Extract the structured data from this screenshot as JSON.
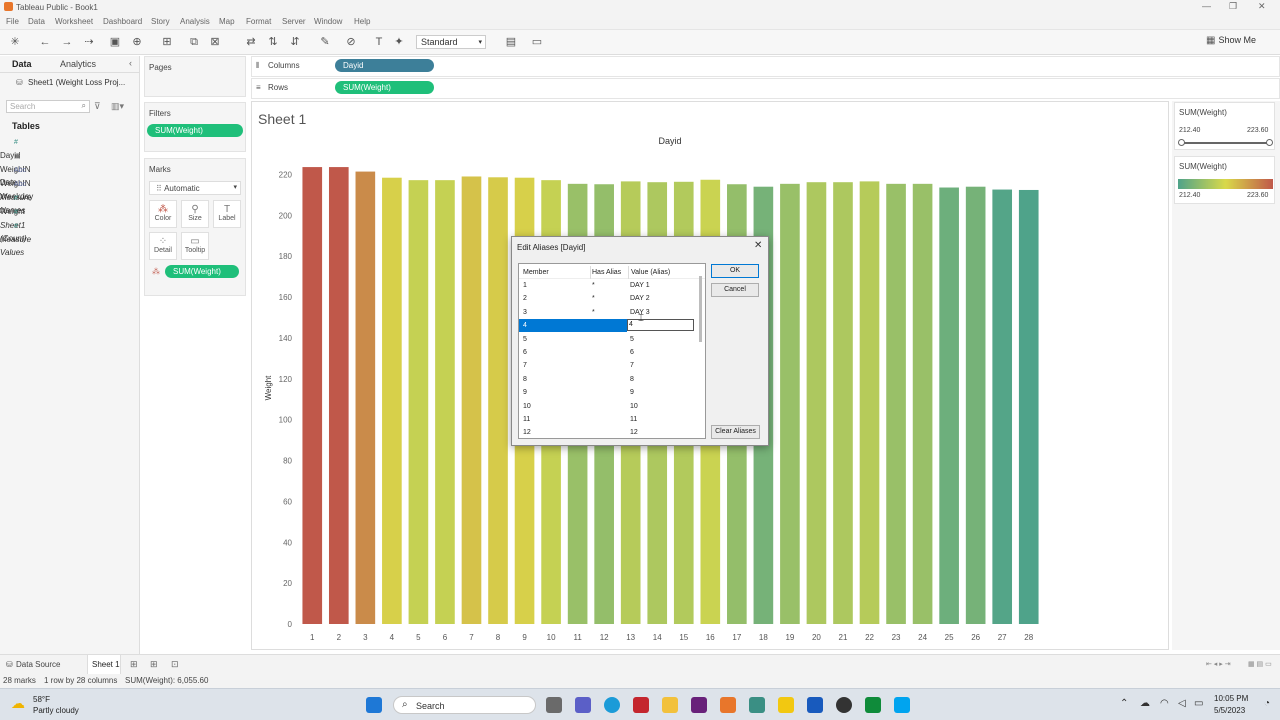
{
  "window": {
    "title": "Tableau Public - Book1"
  },
  "menu": [
    "File",
    "Data",
    "Worksheet",
    "Dashboard",
    "Story",
    "Analysis",
    "Map",
    "Format",
    "Server",
    "Window",
    "Help"
  ],
  "toolbar": {
    "fit_mode": "Standard",
    "show_me": "Show Me"
  },
  "left_pane": {
    "tabs": {
      "data": "Data",
      "analytics": "Analytics"
    },
    "datasource": "Sheet1 (Weight Loss Proj...",
    "search_placeholder": "Search",
    "tables_heading": "Tables",
    "fields": [
      {
        "type": "#",
        "name": "Dayid",
        "italic": false
      },
      {
        "type": "dt",
        "name": "WeighIN Date",
        "italic": false
      },
      {
        "type": "Abc",
        "name": "WeighIN Weekday",
        "italic": false
      },
      {
        "type": "Abc",
        "name": "Measure Names",
        "italic": true
      },
      {
        "type": "#",
        "name": "Weight",
        "italic": false
      },
      {
        "type": "#",
        "name": "Sheet1 (Count)",
        "italic": true
      },
      {
        "type": "#",
        "name": "Measure Values",
        "italic": true
      }
    ]
  },
  "cards": {
    "pages": "Pages",
    "filters": "Filters",
    "filter_pill": "SUM(Weight)",
    "marks": "Marks",
    "mark_type": "Automatic",
    "mark_buttons": [
      "Color",
      "Size",
      "Label",
      "Detail",
      "Tooltip"
    ],
    "marks_pill": "SUM(Weight)"
  },
  "shelves": {
    "columns_label": "Columns",
    "columns_pill": "Dayid",
    "rows_label": "Rows",
    "rows_pill": "SUM(Weight)"
  },
  "sheet": {
    "title": "Sheet 1"
  },
  "right_pane": {
    "filter_title": "SUM(Weight)",
    "filter_min": "212.40",
    "filter_max": "223.60",
    "legend_title": "SUM(Weight)",
    "legend_min": "212.40",
    "legend_max": "223.60"
  },
  "chart_data": {
    "type": "bar",
    "title": "Dayid",
    "xlabel": "",
    "ylabel": "Weight",
    "ylim": [
      0,
      230
    ],
    "yticks": [
      0,
      20,
      40,
      60,
      80,
      100,
      120,
      140,
      160,
      180,
      200,
      220
    ],
    "categories": [
      "1",
      "2",
      "3",
      "4",
      "5",
      "6",
      "7",
      "8",
      "9",
      "10",
      "11",
      "12",
      "13",
      "14",
      "15",
      "16",
      "17",
      "18",
      "19",
      "20",
      "21",
      "22",
      "23",
      "24",
      "25",
      "26",
      "27",
      "28"
    ],
    "values": [
      223.6,
      223.6,
      221.4,
      218.4,
      217.2,
      217.2,
      219,
      218.6,
      218.4,
      217.2,
      215.4,
      215.2,
      216.6,
      216.2,
      216.4,
      217.4,
      215.2,
      214,
      215.4,
      216.2,
      216.2,
      216.6,
      215.4,
      215.4,
      213.6,
      214,
      212.6,
      212.4
    ],
    "color_scale": {
      "min": 212.4,
      "max": 223.6,
      "low": "#4fa38a",
      "mid": "#d9d94a",
      "high": "#c0584a"
    }
  },
  "dialog": {
    "title": "Edit Aliases [Dayid]",
    "columns": [
      "Member",
      "Has Alias",
      "Value (Alias)"
    ],
    "rows": [
      {
        "member": "1",
        "has_alias": "*",
        "value": "DAY 1"
      },
      {
        "member": "2",
        "has_alias": "*",
        "value": "DAY 2"
      },
      {
        "member": "3",
        "has_alias": "*",
        "value": "DAY 3"
      },
      {
        "member": "4",
        "has_alias": "",
        "value": "4"
      },
      {
        "member": "5",
        "has_alias": "",
        "value": "5"
      },
      {
        "member": "6",
        "has_alias": "",
        "value": "6"
      },
      {
        "member": "7",
        "has_alias": "",
        "value": "7"
      },
      {
        "member": "8",
        "has_alias": "",
        "value": "8"
      },
      {
        "member": "9",
        "has_alias": "",
        "value": "9"
      },
      {
        "member": "10",
        "has_alias": "",
        "value": "10"
      },
      {
        "member": "11",
        "has_alias": "",
        "value": "11"
      },
      {
        "member": "12",
        "has_alias": "",
        "value": "12"
      }
    ],
    "ok": "OK",
    "cancel": "Cancel",
    "clear": "Clear Aliases"
  },
  "bottom_tabs": {
    "datasource": "Data Source",
    "sheet": "Sheet 1"
  },
  "status": {
    "marks": "28 marks",
    "rows_cols": "1 row by 28 columns",
    "sum": "SUM(Weight): 6,055.60"
  },
  "taskbar": {
    "temp": "58°F",
    "weather": "Partly cloudy",
    "search": "Search",
    "time": "10:05 PM",
    "date": "5/5/2023"
  }
}
